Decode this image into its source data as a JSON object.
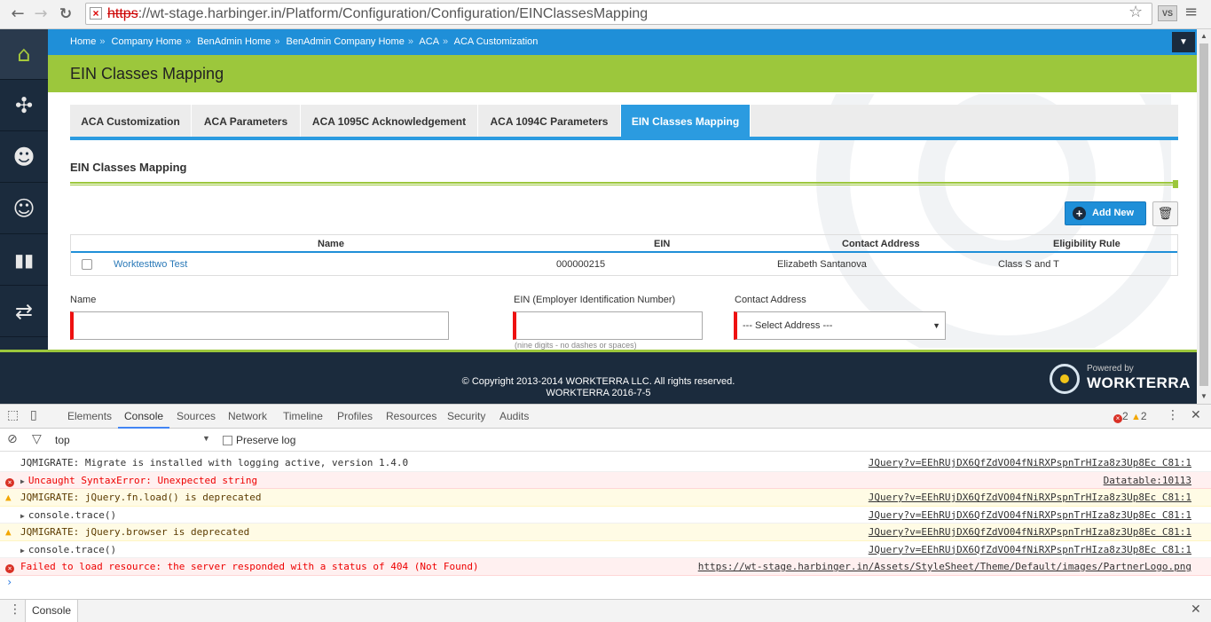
{
  "browser": {
    "url_protocol": "https",
    "url_rest": "://wt-stage.harbinger.in/Platform/Configuration/Configuration/EINClassesMapping",
    "back_icon": "←",
    "forward_icon": "→",
    "reload_icon": "C",
    "extension_label": "VS"
  },
  "breadcrumb": [
    "Home",
    "Company Home",
    "BenAdmin Home",
    "BenAdmin Company Home",
    "ACA",
    "ACA Customization"
  ],
  "breadcrumb_sep": "»",
  "page_title": "EIN Classes Mapping",
  "tabs": [
    "ACA Customization",
    "ACA Parameters",
    "ACA 1095C Acknowledgement",
    "ACA 1094C Parameters",
    "EIN Classes Mapping"
  ],
  "active_tab": "EIN Classes Mapping",
  "section_title": "EIN Classes Mapping",
  "add_button": "Add New",
  "table": {
    "columns": [
      "Name",
      "EIN",
      "Contact Address",
      "Eligibility Rule"
    ],
    "rows": [
      {
        "name": "Worktesttwo Test",
        "ein": "000000215",
        "contact": "Elizabeth Santanova",
        "rule": "Class S and T"
      }
    ]
  },
  "form": {
    "name_label": "Name",
    "name_value": "",
    "ein_label": "EIN (Employer Identification Number)",
    "ein_value": "",
    "ein_hint": "(nine digits - no dashes or spaces)",
    "contact_label": "Contact Address",
    "contact_selected": "--- Select Address ---"
  },
  "footer": {
    "copyright": "© Copyright 2013-2014 WORKTERRA LLC. All rights reserved.",
    "version": "WORKTERRA 2016-7-5",
    "powered_by": "Powered by",
    "brand": "WORKTERRA"
  },
  "devtools": {
    "tabs": [
      "Elements",
      "Console",
      "Sources",
      "Network",
      "Timeline",
      "Profiles",
      "Resources",
      "Security",
      "Audits"
    ],
    "active_tab": "Console",
    "error_count": "2",
    "warning_count": "2",
    "context": "top",
    "preserve_log": "Preserve log",
    "drawer_tab": "Console",
    "logs": [
      {
        "type": "info",
        "text": "JQMIGRATE: Migrate is installed with logging active, version 1.4.0",
        "source": "JQuery?v=EEhRUjDX6QfZdVO04fNiRXPspnTrHIza8z3Up8Ec C81:1"
      },
      {
        "type": "error",
        "text": "Uncaught SyntaxError: Unexpected string",
        "source": "Datatable:10113"
      },
      {
        "type": "warn",
        "text": "JQMIGRATE: jQuery.fn.load() is deprecated",
        "source": "JQuery?v=EEhRUjDX6QfZdVO04fNiRXPspnTrHIza8z3Up8Ec C81:1"
      },
      {
        "type": "trace",
        "text": "console.trace()",
        "source": "JQuery?v=EEhRUjDX6QfZdVO04fNiRXPspnTrHIza8z3Up8Ec C81:1"
      },
      {
        "type": "warn",
        "text": "JQMIGRATE: jQuery.browser is deprecated",
        "source": "JQuery?v=EEhRUjDX6QfZdVO04fNiRXPspnTrHIza8z3Up8Ec C81:1"
      },
      {
        "type": "trace",
        "text": "console.trace()",
        "source": "JQuery?v=EEhRUjDX6QfZdVO04fNiRXPspnTrHIza8z3Up8Ec C81:1"
      },
      {
        "type": "error",
        "text": "Failed to load resource: the server responded with a status of 404 (Not Found)",
        "source": "https://wt-stage.harbinger.in/Assets/StyleSheet/Theme/Default/images/PartnerLogo.png"
      }
    ]
  },
  "colors": {
    "accent_blue": "#1f8fd8",
    "accent_green": "#9cc73c",
    "sidebar": "#1b2b3d",
    "required_red": "#ee1111"
  }
}
